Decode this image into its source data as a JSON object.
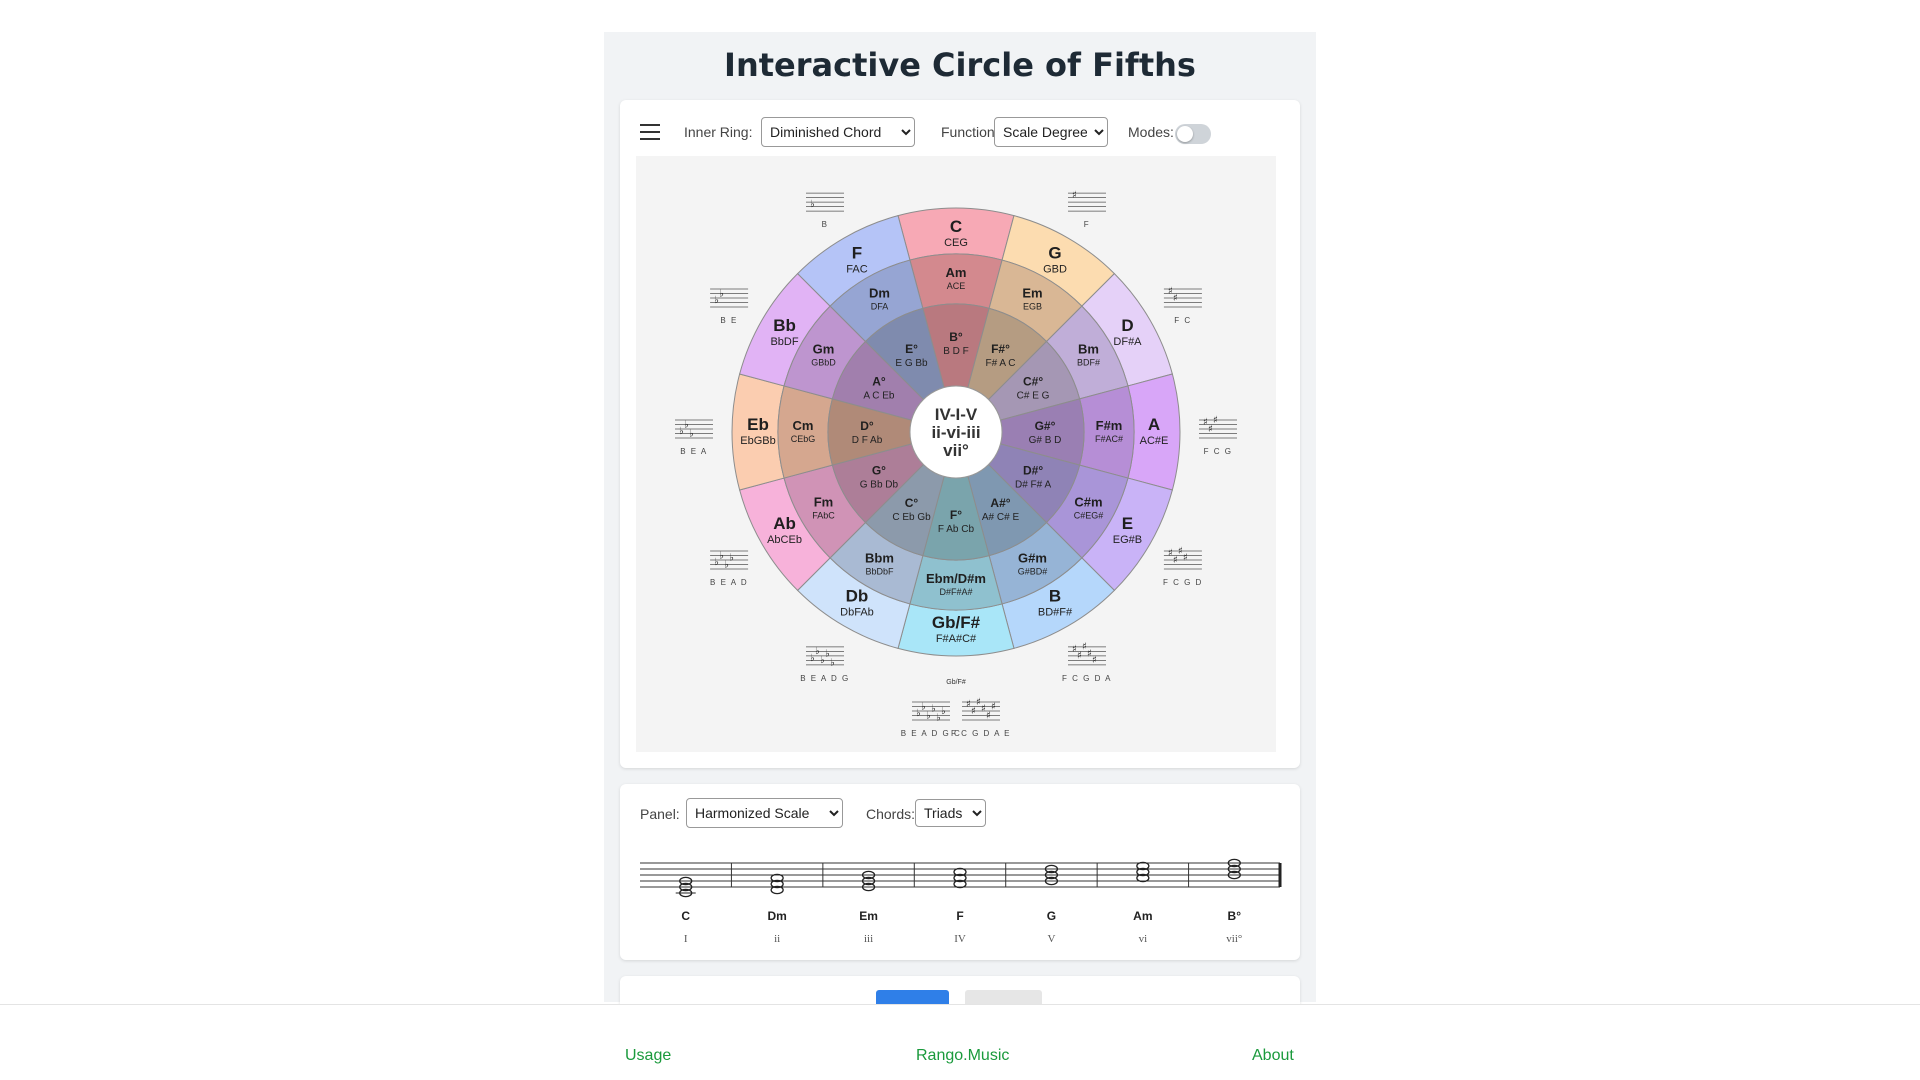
{
  "title": "Interactive Circle of Fifths",
  "toolbar": {
    "inner_ring_label": "Inner Ring:",
    "inner_ring_value": "Diminished Chord",
    "function_label": "Function:",
    "function_value": "Scale Degree",
    "modes_label": "Modes:",
    "modes_on": false
  },
  "wheel": {
    "center_lines": [
      "IV-I-V",
      "ii-vi-iii",
      "vii°"
    ],
    "major": [
      {
        "name": "C",
        "notes": "CEG",
        "color": "#f7a9b5"
      },
      {
        "name": "G",
        "notes": "GBD",
        "color": "#fcdcb0"
      },
      {
        "name": "D",
        "notes": "DF#A",
        "color": "#e5d1f8"
      },
      {
        "name": "A",
        "notes": "AC#E",
        "color": "#d8a6f8"
      },
      {
        "name": "E",
        "notes": "EG#B",
        "color": "#c9b3f7"
      },
      {
        "name": "B",
        "notes": "BD#F#",
        "color": "#b5d7fb"
      },
      {
        "name": "Gb/F#",
        "notes": "F#A#C#",
        "color": "#a9e6f8"
      },
      {
        "name": "Db",
        "notes": "DbFAb",
        "color": "#cfe3fb"
      },
      {
        "name": "Ab",
        "notes": "AbCEb",
        "color": "#f7b2da"
      },
      {
        "name": "Eb",
        "notes": "EbGBb",
        "color": "#fbcdb0"
      },
      {
        "name": "Bb",
        "notes": "BbDF",
        "color": "#e1b3f5"
      },
      {
        "name": "F",
        "notes": "FAC",
        "color": "#b5c4f7"
      }
    ],
    "minor": [
      {
        "name": "Am",
        "notes": "ACE",
        "color": "#d3898e"
      },
      {
        "name": "Em",
        "notes": "EGB",
        "color": "#d9b795"
      },
      {
        "name": "Bm",
        "notes": "BDF#",
        "color": "#c0aed8"
      },
      {
        "name": "F#m",
        "notes": "F#AC#",
        "color": "#b68ed6"
      },
      {
        "name": "C#m",
        "notes": "C#EG#",
        "color": "#a995d8"
      },
      {
        "name": "G#m",
        "notes": "G#BD#",
        "color": "#96b4d6"
      },
      {
        "name": "Ebm/D#m",
        "notes": "D#F#A#",
        "color": "#8fc1cf"
      },
      {
        "name": "Bbm",
        "notes": "BbDbF",
        "color": "#a9bad3"
      },
      {
        "name": "Fm",
        "notes": "FAbC",
        "color": "#d093b6"
      },
      {
        "name": "Cm",
        "notes": "CEbG",
        "color": "#d5a78f"
      },
      {
        "name": "Gm",
        "notes": "GBbD",
        "color": "#be95cf"
      },
      {
        "name": "Dm",
        "notes": "DFA",
        "color": "#96a5d3"
      }
    ],
    "dim": [
      {
        "name": "B°",
        "notes": "B D F",
        "color": "#b9797f"
      },
      {
        "name": "F#°",
        "notes": "F# A C",
        "color": "#b59c82"
      },
      {
        "name": "C#°",
        "notes": "C# E G",
        "color": "#a597b4"
      },
      {
        "name": "G#°",
        "notes": "G# B D",
        "color": "#9a7fb3"
      },
      {
        "name": "D#°",
        "notes": "D# F# A",
        "color": "#8f83b6"
      },
      {
        "name": "A#°",
        "notes": "A# C# E",
        "color": "#7f98b1"
      },
      {
        "name": "F°",
        "notes": "F Ab Cb",
        "color": "#7aa4ac"
      },
      {
        "name": "C°",
        "notes": "C Eb Gb",
        "color": "#8c9aab"
      },
      {
        "name": "G°",
        "notes": "G Bb Db",
        "color": "#ad7e98"
      },
      {
        "name": "D°",
        "notes": "D F Ab",
        "color": "#b08a78"
      },
      {
        "name": "A°",
        "notes": "A C Eb",
        "color": "#a17fad"
      },
      {
        "name": "E°",
        "notes": "E G Bb",
        "color": "#7f8bae"
      }
    ],
    "key_sigs": [
      {
        "acc": "",
        "n": 0,
        "label": "",
        "spelled": ""
      },
      {
        "acc": "#",
        "n": 1,
        "label": "F",
        "spelled": ""
      },
      {
        "acc": "#",
        "n": 2,
        "label": "F C",
        "spelled": ""
      },
      {
        "acc": "#",
        "n": 3,
        "label": "F C G",
        "spelled": ""
      },
      {
        "acc": "#",
        "n": 4,
        "label": "F C G D",
        "spelled": ""
      },
      {
        "acc": "#",
        "n": 5,
        "label": "F C G D A",
        "spelled": ""
      },
      {
        "acc": "b",
        "n": 6,
        "label": "B E A D G C",
        "spelled": "Gb/F#"
      },
      {
        "acc": "b",
        "n": 5,
        "label": "B E A D G",
        "spelled": ""
      },
      {
        "acc": "b",
        "n": 4,
        "label": "B E A D",
        "spelled": ""
      },
      {
        "acc": "b",
        "n": 3,
        "label": "B E A",
        "spelled": ""
      },
      {
        "acc": "b",
        "n": 2,
        "label": "B E",
        "spelled": ""
      },
      {
        "acc": "b",
        "n": 1,
        "label": "B",
        "spelled": ""
      }
    ],
    "fsharp_sig": {
      "acc": "#",
      "n": 6,
      "label": "F C G D A E"
    }
  },
  "panel": {
    "panel_label": "Panel:",
    "panel_value": "Harmonized Scale",
    "chords_label": "Chords:",
    "chords_value": "Triads",
    "chords": [
      {
        "name": "C",
        "degree": "I"
      },
      {
        "name": "Dm",
        "degree": "ii"
      },
      {
        "name": "Em",
        "degree": "iii"
      },
      {
        "name": "F",
        "degree": "IV"
      },
      {
        "name": "G",
        "degree": "V"
      },
      {
        "name": "Am",
        "degree": "vi"
      },
      {
        "name": "B°",
        "degree": "vii°"
      }
    ]
  },
  "footer": {
    "usage": "Usage",
    "brand": "Rango.Music",
    "about": "About"
  }
}
